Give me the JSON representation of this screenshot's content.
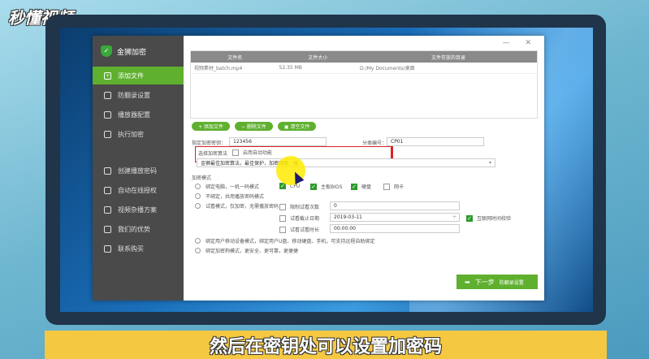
{
  "watermark": "秒懂视频",
  "caption": "然后在密钥处可以设置加密码",
  "app": {
    "title": "金狮加密",
    "window_controls": "— ✕"
  },
  "sidebar": {
    "items": [
      {
        "label": "添加文件",
        "active": true,
        "icon": "file-add-icon"
      },
      {
        "label": "防翻录设置",
        "icon": "shield-icon"
      },
      {
        "label": "播放器配置",
        "icon": "player-icon"
      },
      {
        "label": "执行加密",
        "icon": "lock-icon"
      },
      {
        "label": "创建播放密码",
        "icon": "user-icon"
      },
      {
        "label": "自动在线授权",
        "icon": "globe-icon"
      },
      {
        "label": "视频杂播方案",
        "icon": "mobile-icon"
      },
      {
        "label": "我们的优势",
        "icon": "thumb-icon"
      },
      {
        "label": "联系购买",
        "icon": "cart-icon"
      }
    ]
  },
  "table": {
    "headers": [
      "文件名",
      "文件大小",
      "文件存放的目录"
    ],
    "rows": [
      [
        "视频素材_batch.mp4",
        "52.35 MB",
        "D:/My Documents/桌面"
      ]
    ]
  },
  "buttons": {
    "add": "+ 添加文件",
    "delete": "− 删除文件",
    "clear": "▣ 清空文件"
  },
  "form": {
    "password_label": "指定加密密钥：",
    "password_value": "123456",
    "category_label": "分类编号：",
    "category_value": "CP01",
    "algo_label": "选择加密算法",
    "autoplay_label": "启用自动功能",
    "algo_select": "金狮最佳加密算法，最佳保护，加密强度：强",
    "mode_label": "加密模式",
    "mode1": "绑定电脑，一机一码模式",
    "mode2": "不绑定，共用播放密码模式",
    "mode3": "试看模式，仅加密，无需播放密码",
    "cpu": "CPU",
    "bios": "主板BIOS",
    "disk": "硬盘",
    "net": "网卡",
    "limit_count": "限制试看次数",
    "count_value": "0",
    "expire_label": "试看截止日期",
    "expire_value": "2019-03-11",
    "internet_time": "互联网时间校验",
    "duration_label": "试看试看时长",
    "duration_value": "00:00:00",
    "mode4": "绑定用户移动设备模式，绑定用户U盘、移动硬盘、手机，可支持远程自助绑定",
    "mode5": "绑定加密狗模式，更安全、更可靠，更便捷"
  },
  "next": {
    "label": "下一步",
    "sub": "防翻录设置"
  }
}
